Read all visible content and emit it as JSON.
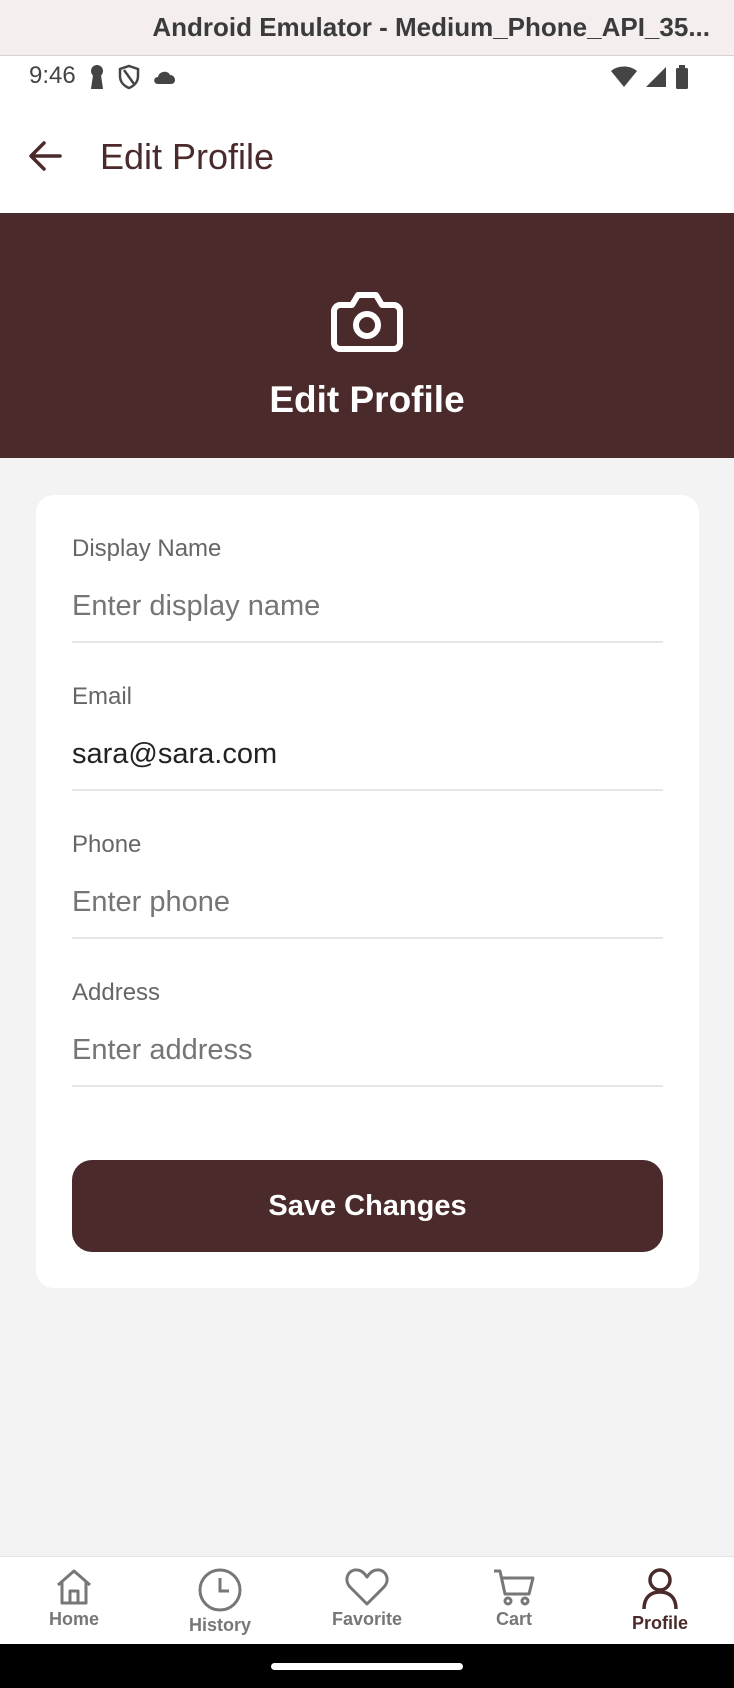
{
  "emulator": {
    "title": "Android Emulator - Medium_Phone_API_35..."
  },
  "status_bar": {
    "time": "9:46"
  },
  "appbar": {
    "title": "Edit Profile"
  },
  "banner": {
    "title": "Edit Profile"
  },
  "form": {
    "fields": [
      {
        "label": "Display Name",
        "value": "",
        "placeholder": "Enter display name"
      },
      {
        "label": "Email",
        "value": "sara@sara.com",
        "placeholder": ""
      },
      {
        "label": "Phone",
        "value": "",
        "placeholder": "Enter phone"
      },
      {
        "label": "Address",
        "value": "",
        "placeholder": "Enter address"
      }
    ],
    "save_label": "Save Changes"
  },
  "nav": {
    "items": [
      {
        "label": "Home",
        "icon": "home-icon"
      },
      {
        "label": "History",
        "icon": "clock-icon"
      },
      {
        "label": "Favorite",
        "icon": "heart-icon"
      },
      {
        "label": "Cart",
        "icon": "cart-icon"
      },
      {
        "label": "Profile",
        "icon": "person-icon"
      }
    ],
    "active": "Profile"
  },
  "colors": {
    "brand": "#4a2a2a",
    "background": "#f3f3f3"
  }
}
